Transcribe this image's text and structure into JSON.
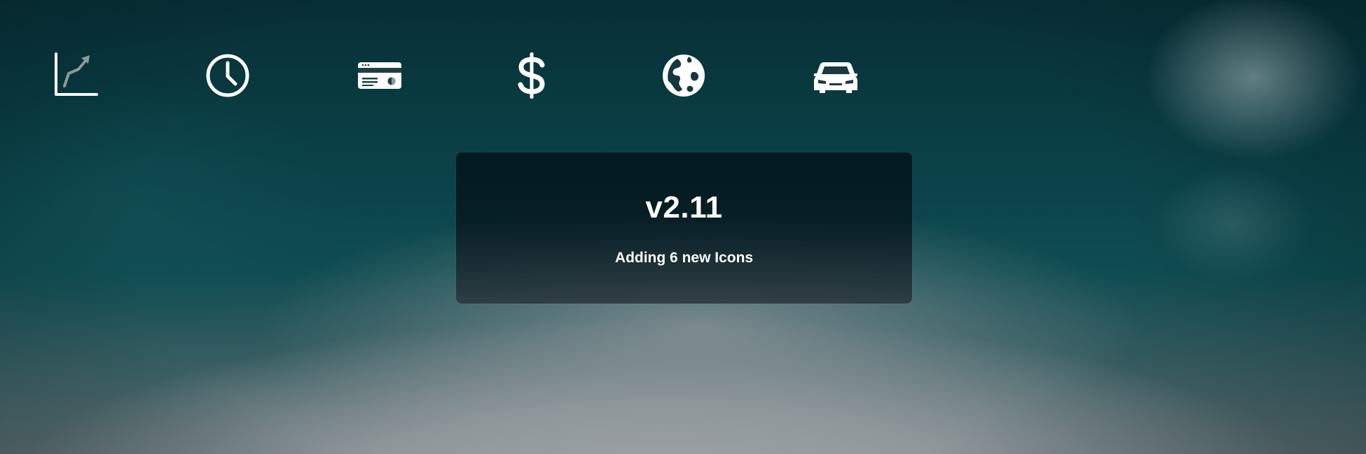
{
  "icons": [
    {
      "name": "chart-line-icon"
    },
    {
      "name": "clock-icon"
    },
    {
      "name": "credit-card-icon"
    },
    {
      "name": "dollar-icon"
    },
    {
      "name": "globe-icon"
    },
    {
      "name": "car-icon"
    }
  ],
  "release": {
    "version": "v2.11",
    "description": "Adding 6 new Icons"
  },
  "colors": {
    "icon": "#ffffff",
    "icon_accent": "#8a9a9c",
    "card_bg": "#05181e"
  }
}
